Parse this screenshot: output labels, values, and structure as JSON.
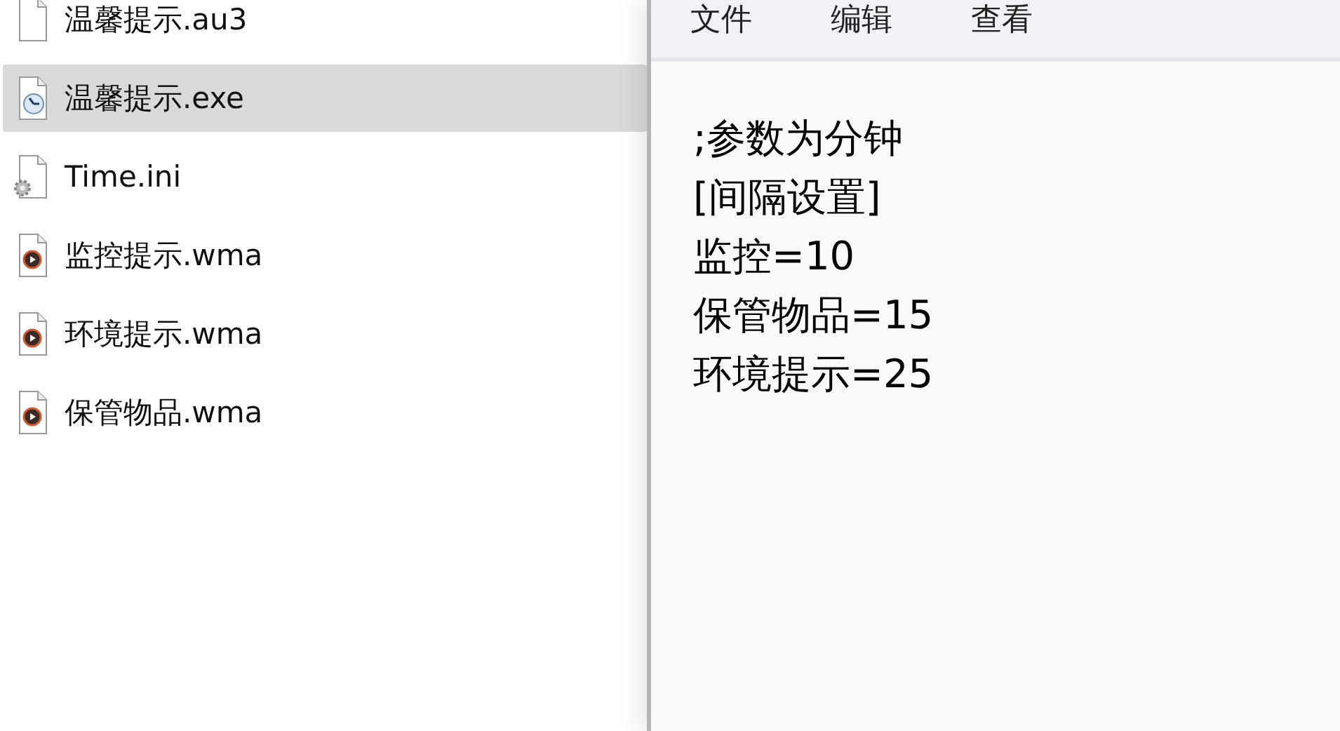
{
  "files": [
    {
      "name": "温馨提示.au3",
      "kind": "blank",
      "selected": false
    },
    {
      "name": "温馨提示.exe",
      "kind": "app",
      "selected": true
    },
    {
      "name": "Time.ini",
      "kind": "settings",
      "selected": false
    },
    {
      "name": "监控提示.wma",
      "kind": "media",
      "selected": false
    },
    {
      "name": "环境提示.wma",
      "kind": "media",
      "selected": false
    },
    {
      "name": "保管物品.wma",
      "kind": "media",
      "selected": false
    }
  ],
  "editor": {
    "menu": [
      "文件",
      "编辑",
      "查看"
    ],
    "lines": [
      ";参数为分钟",
      "[间隔设置]",
      "监控=10",
      "保管物品=15",
      "环境提示=25"
    ]
  }
}
